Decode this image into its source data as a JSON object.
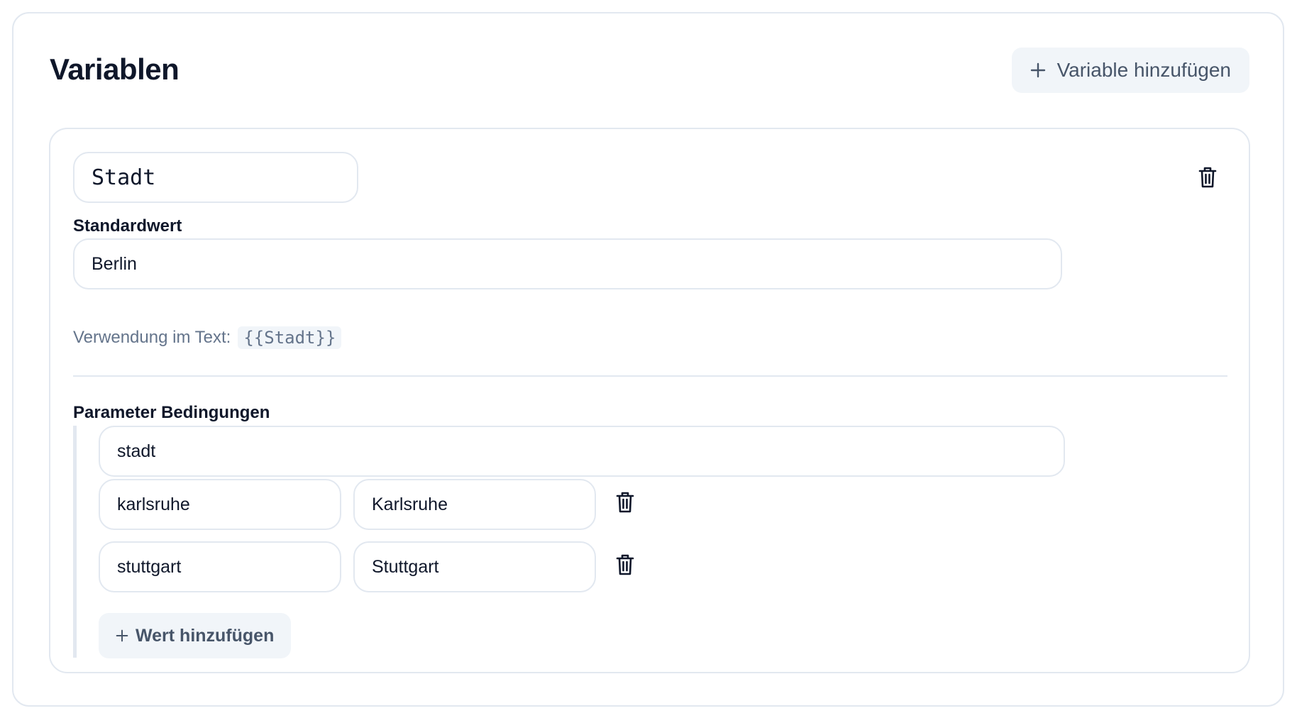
{
  "header": {
    "title": "Variablen",
    "add_variable_label": "Variable hinzufügen"
  },
  "variable": {
    "name": "Stadt",
    "default_label": "Standardwert",
    "default_value": "Berlin",
    "usage_label": "Verwendung im Text:",
    "usage_code": "{{Stadt}}",
    "conditions_label": "Parameter Bedingungen",
    "parameter_name": "stadt",
    "mappings": [
      {
        "key": "karlsruhe",
        "value": "Karlsruhe"
      },
      {
        "key": "stuttgart",
        "value": "Stuttgart"
      }
    ],
    "add_value_label": "Wert hinzufügen"
  },
  "icons": {
    "add": "plus-icon",
    "delete": "trash-icon"
  },
  "colors": {
    "border": "#e2e8f0",
    "button_bg": "#f1f5f9",
    "muted_text": "#64748b",
    "button_text": "#475569",
    "heading": "#0f172a"
  }
}
